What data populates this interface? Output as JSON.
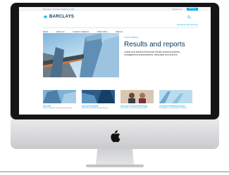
{
  "site": {
    "utility_left": "Barclays | Investor Relations | EN",
    "utility_contact": "Contact us",
    "utility_button": "Barclays",
    "logo_text": "BARCLAYS",
    "nav": [
      "News",
      "About us",
      "Investor relations",
      "Citizenship",
      "Careers"
    ],
    "nav_secondary": "Products and services",
    "breadcrumb": "Investor Relations",
    "hero_title": "Results and reports",
    "hero_description": "Latest and archived financial results announcements, management presentations, webcasts and archive.",
    "tiles": [
      {
        "title": "Results",
        "desc": "Latest financial results announcements"
      },
      {
        "title": "Annual Reports",
        "desc": "Latest and archived annual reports"
      },
      {
        "title": "Annual General Meetings",
        "desc": "Information on our AGM and events"
      },
      {
        "title": "General Meeting Archive",
        "desc": "Information on our previous meetings"
      }
    ]
  },
  "icons": {
    "apple": "apple-logo-icon",
    "search": "search-icon",
    "brand": "eagle-icon"
  },
  "colors": {
    "brand_navy": "#00395d",
    "brand_blue": "#00aeef",
    "bezel": "#151515",
    "chin": "#e9e9ea"
  }
}
